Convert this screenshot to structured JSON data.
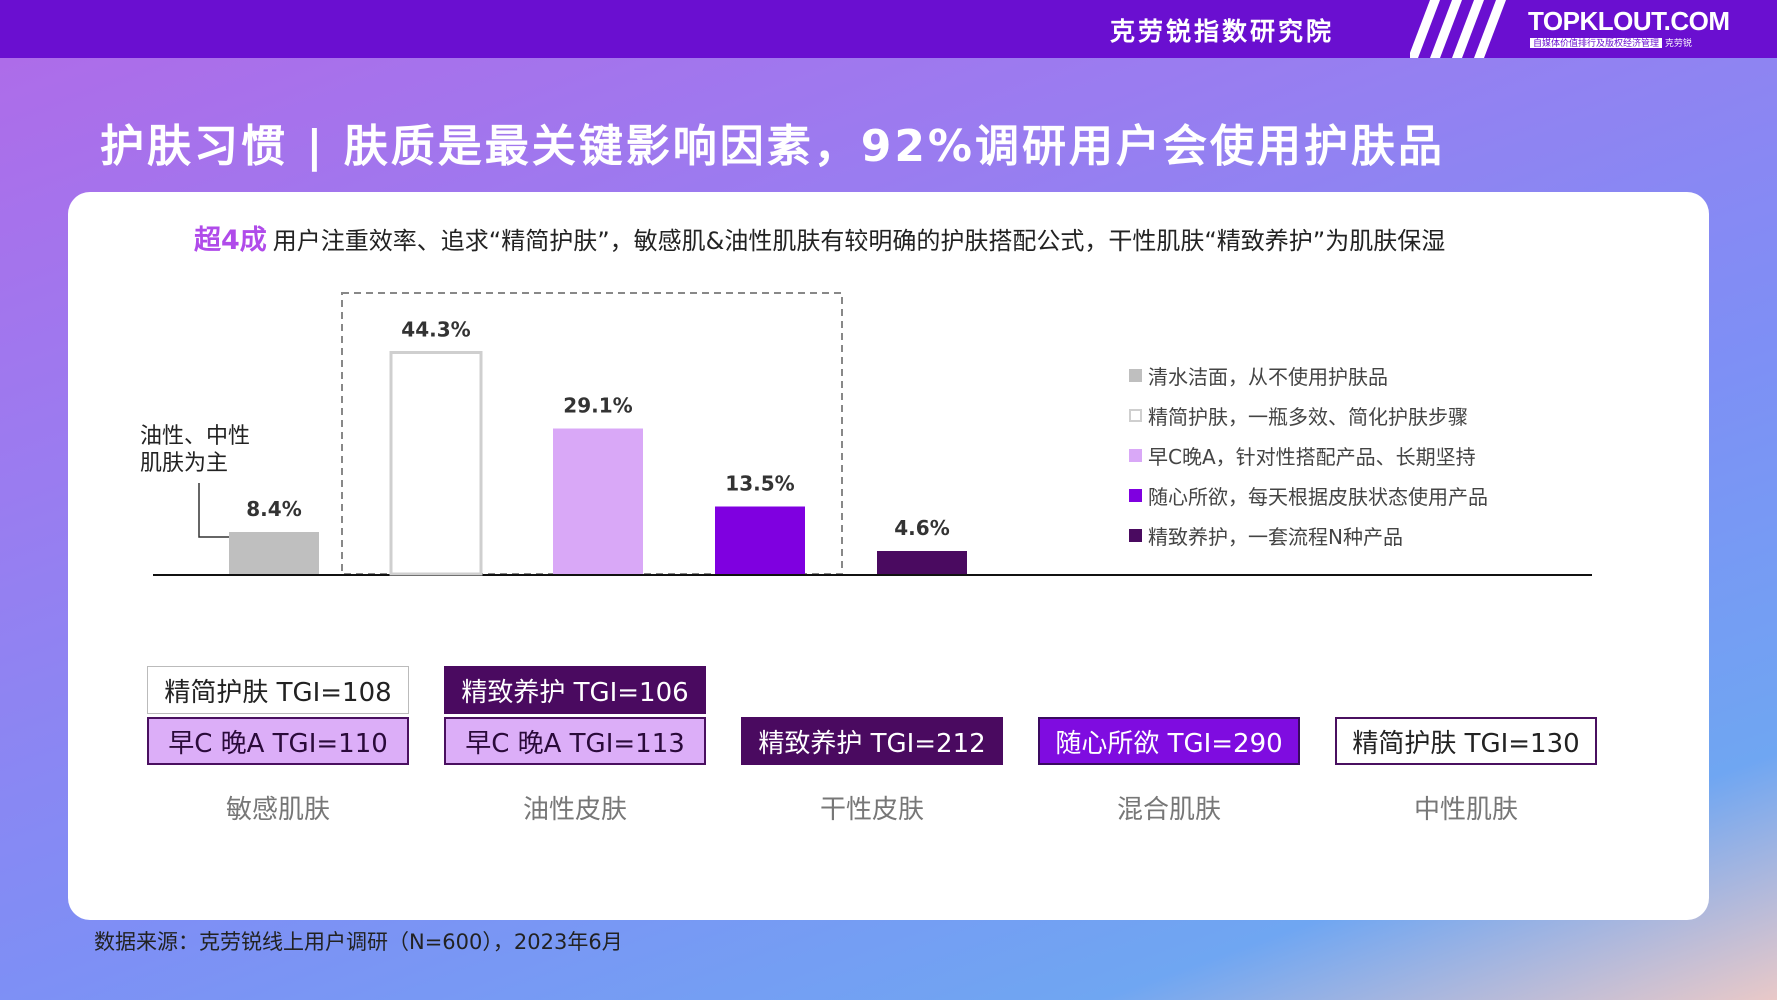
{
  "header": {
    "org_name": "克劳锐指数研究院",
    "brand": "TOPKLOUT.COM",
    "brand_tagline": "自媒体价值排行及版权经济管理",
    "brand_tagline_cn": "克劳锐"
  },
  "headline": "护肤习惯 | 肤质是最关键影响因素，92%调研用户会使用护肤品",
  "subtitle": {
    "highlight": "超4成",
    "text": "用户注重效率、追求“精简护肤”，敏感肌&油性肌肤有较明确的护肤搭配公式，干性肌肤“精致养护”为肌肤保湿"
  },
  "chart_data": {
    "type": "bar",
    "categories": [
      "清水洁面，从不使用护肤品",
      "精简护肤，一瓶多效、简化护肤步骤",
      "早C晚A，针对性搭配产品、长期坚持",
      "随心所欲，每天根据皮肤状态使用产品",
      "精致养护，一套流程N种产品"
    ],
    "values": [
      8.4,
      44.3,
      29.1,
      13.5,
      4.6
    ],
    "value_labels": [
      "8.4%",
      "44.3%",
      "29.1%",
      "13.5%",
      "4.6%"
    ],
    "colors": [
      "#bfbfbf",
      "#ffffff",
      "#d9a8f7",
      "#7f00e0",
      "#4a0a60"
    ],
    "ylim": [
      0,
      50
    ],
    "grid": false,
    "legend_position": "right",
    "annotation": [
      "油性、中性",
      "肌肤为主"
    ]
  },
  "tgi_groups": [
    {
      "skin": "敏感肌肤",
      "tags": [
        {
          "label": "精简护肤 TGI=108",
          "style": "jingjian"
        },
        {
          "label": "早C 晚A   TGI=110",
          "style": "zaoc"
        }
      ]
    },
    {
      "skin": "油性皮肤",
      "tags": [
        {
          "label": "精致养护 TGI=106",
          "style": "jingzhi"
        },
        {
          "label": "早C 晚A   TGI=113",
          "style": "zaoc"
        }
      ]
    },
    {
      "skin": "干性皮肤",
      "tags": [
        {
          "label": "精致养护 TGI=212",
          "style": "jingzhi"
        }
      ]
    },
    {
      "skin": "混合肌肤",
      "tags": [
        {
          "label": "随心所欲 TGI=290",
          "style": "suixin"
        }
      ]
    },
    {
      "skin": "中性肌肤",
      "tags": [
        {
          "label": "精简护肤 TGI=130",
          "style": "jingjian"
        }
      ]
    }
  ],
  "source": "数据来源：克劳锐线上用户调研（N=600），2023年6月"
}
